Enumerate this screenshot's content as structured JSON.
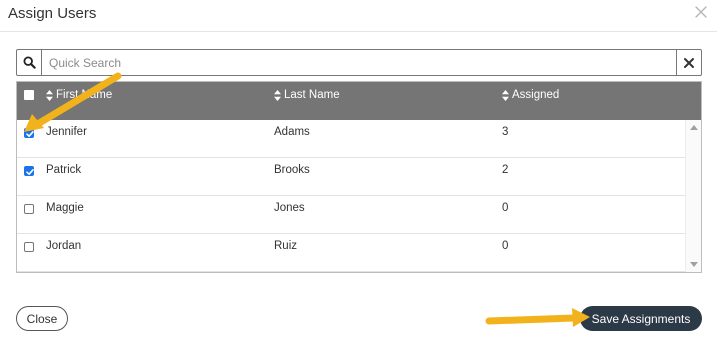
{
  "modal": {
    "title": "Assign Users"
  },
  "search": {
    "placeholder": "Quick Search",
    "value": ""
  },
  "grid": {
    "columns": [
      "First Name",
      "Last Name",
      "Assigned"
    ],
    "rows": [
      {
        "first": "Jennifer",
        "last": "Adams",
        "assigned": "3",
        "checked": true
      },
      {
        "first": "Patrick",
        "last": "Brooks",
        "assigned": "2",
        "checked": true
      },
      {
        "first": "Maggie",
        "last": "Jones",
        "assigned": "0",
        "checked": false
      },
      {
        "first": "Jordan",
        "last": "Ruiz",
        "assigned": "0",
        "checked": false
      }
    ]
  },
  "footer": {
    "close_label": "Close",
    "save_label": "Save Assignments"
  },
  "colors": {
    "header_bg": "#757575",
    "save_button_bg": "#2c3947",
    "checkbox_checked": "#1a73e8",
    "annotation_arrow": "#f2b21b"
  },
  "icons": {
    "search": "search-icon",
    "clear": "close-icon",
    "modal_close": "close-icon",
    "sort": "sort-icon",
    "annotation": "arrow-icon"
  }
}
